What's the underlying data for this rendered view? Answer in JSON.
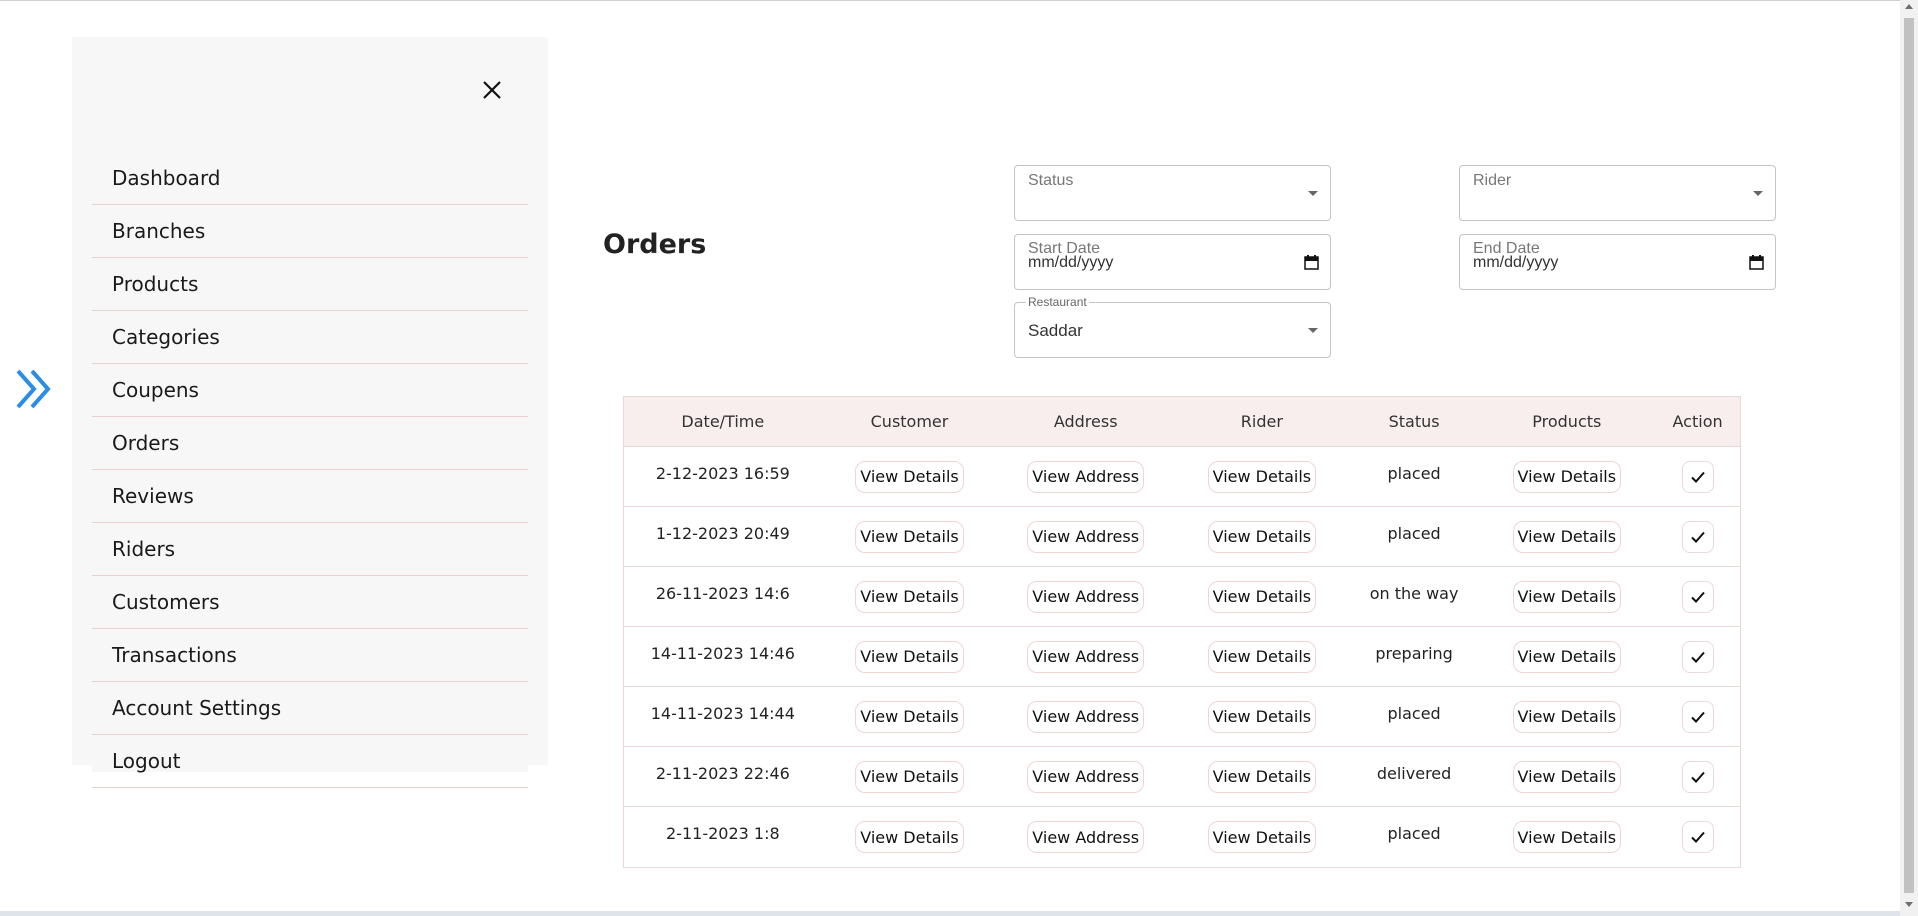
{
  "sidebar": {
    "items": [
      {
        "label": "Dashboard"
      },
      {
        "label": "Branches"
      },
      {
        "label": "Products"
      },
      {
        "label": "Categories"
      },
      {
        "label": "Coupens"
      },
      {
        "label": "Orders"
      },
      {
        "label": "Reviews"
      },
      {
        "label": "Riders"
      },
      {
        "label": "Customers"
      },
      {
        "label": "Transactions"
      },
      {
        "label": "Account Settings"
      },
      {
        "label": "Logout"
      }
    ],
    "close_icon": "close-icon",
    "expand_icon": "double-chevron-right-icon",
    "accent_color": "#2a8ee6"
  },
  "page": {
    "title": "Orders"
  },
  "filters": {
    "status": {
      "label": "Status",
      "value": ""
    },
    "rider": {
      "label": "Rider",
      "value": ""
    },
    "start_date": {
      "label": "Start Date",
      "value": "mm/dd/yyyy"
    },
    "end_date": {
      "label": "End Date",
      "value": "mm/dd/yyyy"
    },
    "restaurant": {
      "label": "Restaurant",
      "value": "Saddar"
    }
  },
  "table": {
    "headers": [
      "Date/Time",
      "Customer",
      "Address",
      "Rider",
      "Status",
      "Products",
      "Action"
    ],
    "buttons": {
      "customer": "View Details",
      "address": "View Address",
      "rider": "View Details",
      "products": "View Details"
    },
    "rows": [
      {
        "datetime": "2-12-2023 16:59",
        "status": "placed"
      },
      {
        "datetime": "1-12-2023 20:49",
        "status": "placed"
      },
      {
        "datetime": "26-11-2023 14:6",
        "status": "on the way"
      },
      {
        "datetime": "14-11-2023 14:46",
        "status": "preparing"
      },
      {
        "datetime": "14-11-2023 14:44",
        "status": "placed"
      },
      {
        "datetime": "2-11-2023 22:46",
        "status": "delivered"
      },
      {
        "datetime": "2-11-2023 1:8",
        "status": "placed"
      }
    ],
    "header_bg": "#f8eeee",
    "border_color": "#ead7d7"
  }
}
